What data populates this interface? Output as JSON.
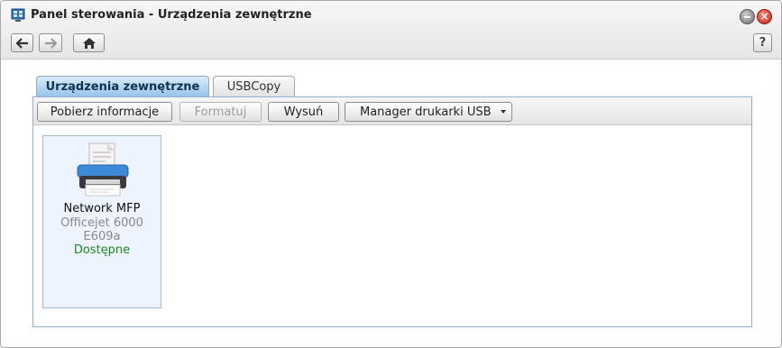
{
  "window": {
    "title": "Panel sterowania - Urządzenia zewnętrzne",
    "help_label": "?"
  },
  "icons": {
    "app": "control-panel-icon",
    "back": "arrow-left-icon",
    "forward": "arrow-right-icon",
    "home": "home-icon",
    "minimize": "minimize-icon",
    "close": "close-icon",
    "device": "printer-icon",
    "dropdown": "caret-down-icon"
  },
  "tabs": [
    {
      "label": "Urządzenia zewnętrzne",
      "active": true
    },
    {
      "label": "USBCopy",
      "active": false
    }
  ],
  "toolbar": {
    "info_label": "Pobierz informacje",
    "format_label": "Formatuj",
    "eject_label": "Wysuń",
    "usb_printer_label": "Manager drukarki USB"
  },
  "device": {
    "name": "Network MFP",
    "model": "Officejet 6000 E609a",
    "status": "Dostępne"
  },
  "colors": {
    "active_tab": "#98c3ea",
    "status_ok": "#1e8a1e",
    "device_bg": "#eef4fd",
    "close": "#c0210f"
  }
}
